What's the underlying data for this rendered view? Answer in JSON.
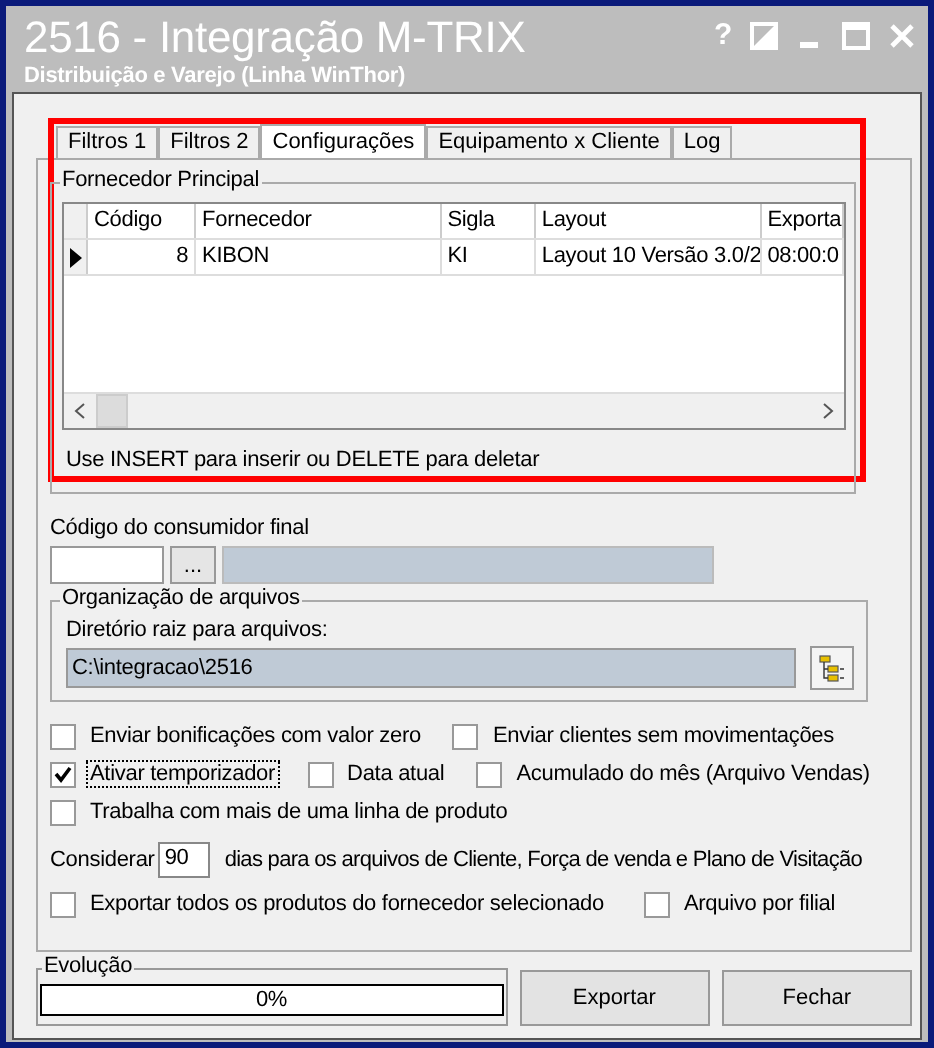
{
  "window": {
    "title": "2516 - Integração M-TRIX",
    "subtitle": "Distribuição e Varejo (Linha WinThor)",
    "help": "?"
  },
  "tabs": [
    {
      "label": "Filtros 1",
      "selected": false
    },
    {
      "label": "Filtros 2",
      "selected": false
    },
    {
      "label": "Configurações",
      "selected": true
    },
    {
      "label": "Equipamento x Cliente",
      "selected": false
    },
    {
      "label": "Log",
      "selected": false
    }
  ],
  "supplier_group": {
    "title": "Fornecedor  Principal",
    "table": {
      "columns": [
        "Código",
        "Fornecedor",
        "Sigla",
        "Layout",
        "Exporta"
      ],
      "rows": [
        {
          "current": true,
          "cells": [
            "8",
            "KIBON",
            "KI",
            "Layout 10 Versão 3.0/2",
            "08:00:0"
          ]
        }
      ]
    },
    "hint": "Use INSERT para inserir ou DELETE para deletar"
  },
  "consumer": {
    "label": "Código do consumidor final",
    "lookup_button": "..."
  },
  "files_group": {
    "title": "Organização de arquivos",
    "dir_label": "Diretório raiz para arquivos:",
    "dir_value": "C:\\integracao\\2516"
  },
  "options": [
    [
      {
        "label": "Enviar bonificações com valor zero",
        "checked": false,
        "focused": false
      },
      {
        "label": "Enviar clientes sem movimentações",
        "checked": false,
        "focused": false
      }
    ],
    [
      {
        "label": "Ativar temporizador",
        "checked": true,
        "focused": true
      },
      {
        "label": "Data atual",
        "checked": false,
        "focused": false
      },
      {
        "label": "Acumulado do mês (Arquivo Vendas)",
        "checked": false,
        "focused": false
      }
    ],
    [
      {
        "label": "Trabalha com mais de uma linha de produto",
        "checked": false,
        "focused": false
      }
    ]
  ],
  "days": {
    "before": "Considerar",
    "value": "90",
    "after": "dias para os arquivos de Cliente, Força de venda e Plano de Visitação"
  },
  "options_2": [
    [
      {
        "label": "Exportar todos os produtos do fornecedor selecionado",
        "checked": false,
        "focused": false
      },
      {
        "label": "Arquivo por filial",
        "checked": false,
        "focused": false
      }
    ]
  ],
  "progress": {
    "title": "Evolução",
    "level": 0,
    "reading": "0%"
  },
  "buttons": [
    "Exportar",
    "Fechar"
  ]
}
